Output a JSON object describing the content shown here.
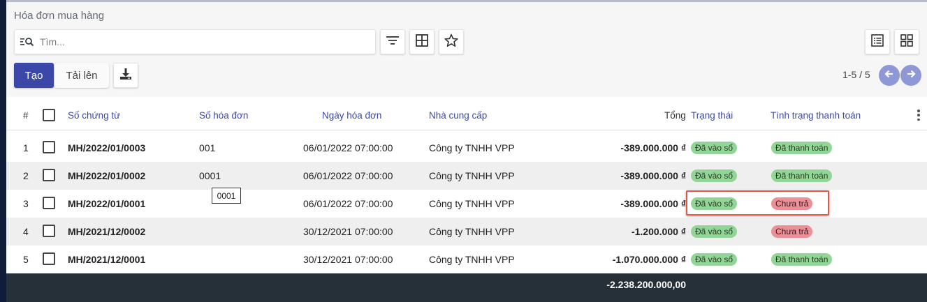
{
  "breadcrumb": "Hóa đơn mua hàng",
  "search": {
    "placeholder": "Tìm..."
  },
  "toolbar": {
    "create_label": "Tạo",
    "upload_label": "Tải lên",
    "icons": [
      "filter-icon",
      "group-by-icon",
      "favorite-icon",
      "download-icon",
      "list-view-icon",
      "kanban-view-icon"
    ]
  },
  "pager": {
    "text": "1-5 / 5"
  },
  "table": {
    "headers": {
      "index": "#",
      "doc_no": "Số chứng từ",
      "invoice_no": "Số hóa đơn",
      "invoice_date": "Ngày hóa đơn",
      "supplier": "Nhà cung cấp",
      "total": "Tổng",
      "status": "Trạng thái",
      "payment_status": "Tình trạng thanh toán"
    },
    "rows": [
      {
        "index": "1",
        "doc_no": "MH/2022/01/0003",
        "invoice_no": "001",
        "invoice_date": "06/01/2022 07:00:00",
        "supplier": "Công ty TNHH VPP",
        "total": "-389.000.000 ₫",
        "status": "Đã vào sổ",
        "payment_status": "Đã thanh toán"
      },
      {
        "index": "2",
        "doc_no": "MH/2022/01/0002",
        "invoice_no": "0001",
        "invoice_date": "06/01/2022 07:00:00",
        "supplier": "Công ty TNHH VPP",
        "total": "-389.000.000 ₫",
        "status": "Đã vào sổ",
        "payment_status": "Đã thanh toán"
      },
      {
        "index": "3",
        "doc_no": "MH/2022/01/0001",
        "invoice_no": "",
        "invoice_date": "06/01/2022 07:00:00",
        "supplier": "Công ty TNHH VPP",
        "total": "-389.000.000 ₫",
        "status": "Đã vào sổ",
        "payment_status": "Chưa trả"
      },
      {
        "index": "4",
        "doc_no": "MH/2021/12/0002",
        "invoice_no": "",
        "invoice_date": "30/12/2021 07:00:00",
        "supplier": "Công ty TNHH VPP",
        "total": "-1.200.000 ₫",
        "status": "Đã vào sổ",
        "payment_status": "Chưa trả"
      },
      {
        "index": "5",
        "doc_no": "MH/2021/12/0001",
        "invoice_no": "",
        "invoice_date": "30/12/2021 07:00:00",
        "supplier": "Công ty TNHH VPP",
        "total": "-1.070.000.000 ₫",
        "status": "Đã vào sổ",
        "payment_status": "Đã thanh toán"
      }
    ],
    "footer_total": "-2.238.200.000,00"
  },
  "tooltip": "0001",
  "colors": {
    "primary": "#3b48a8",
    "badge_green": "#93d497",
    "badge_red": "#ec8f97",
    "highlight": "#e2574a",
    "footer": "#253038"
  }
}
